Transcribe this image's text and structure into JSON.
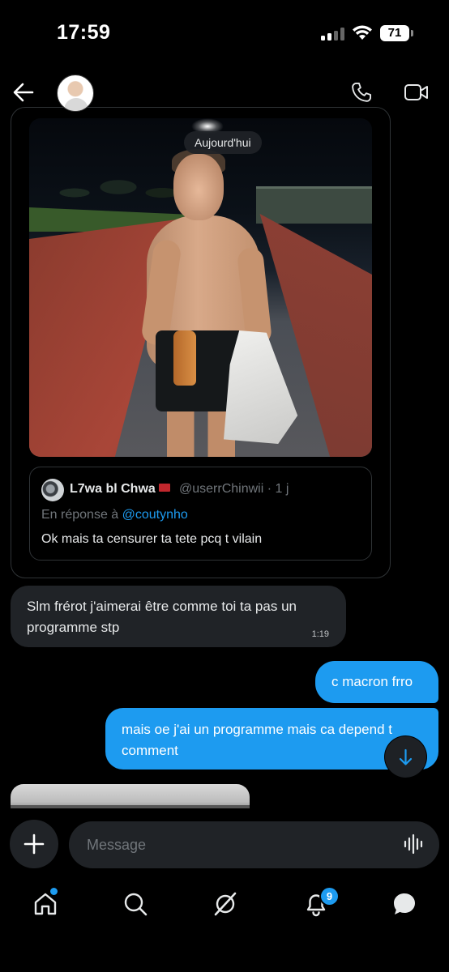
{
  "status_bar": {
    "time": "17:59",
    "battery": "71"
  },
  "chat_header": {
    "contact_avatar": "contact-avatar",
    "icons": [
      "back-arrow-icon",
      "phone-icon",
      "video-camera-icon"
    ]
  },
  "shared_post": {
    "date_separator": "Aujourd'hui",
    "quote": {
      "author_name": "L7wa bl Chwa",
      "handle_time": "@userrChinwii · 1 j",
      "reply_prefix": "En réponse à",
      "reply_mention": "@coutynho",
      "text": "Ok mais ta censurer ta tete pcq t vilain"
    }
  },
  "messages": [
    {
      "direction": "in",
      "text": "Slm frérot j'aimerai être comme toi ta pas un programme stp",
      "time": "1:19"
    },
    {
      "direction": "out",
      "text": "c macron frro"
    },
    {
      "direction": "out",
      "text": "mais oe j'ai un programme mais ca depend t comment"
    }
  ],
  "composer": {
    "placeholder": "Message"
  },
  "bottom_nav": {
    "items": [
      "home-icon",
      "search-icon",
      "grok-icon",
      "notifications-icon",
      "messages-icon"
    ],
    "notifications_count": "9"
  },
  "colors": {
    "accent": "#1d9bf0",
    "bubble_in": "#202327",
    "background": "#000000"
  }
}
